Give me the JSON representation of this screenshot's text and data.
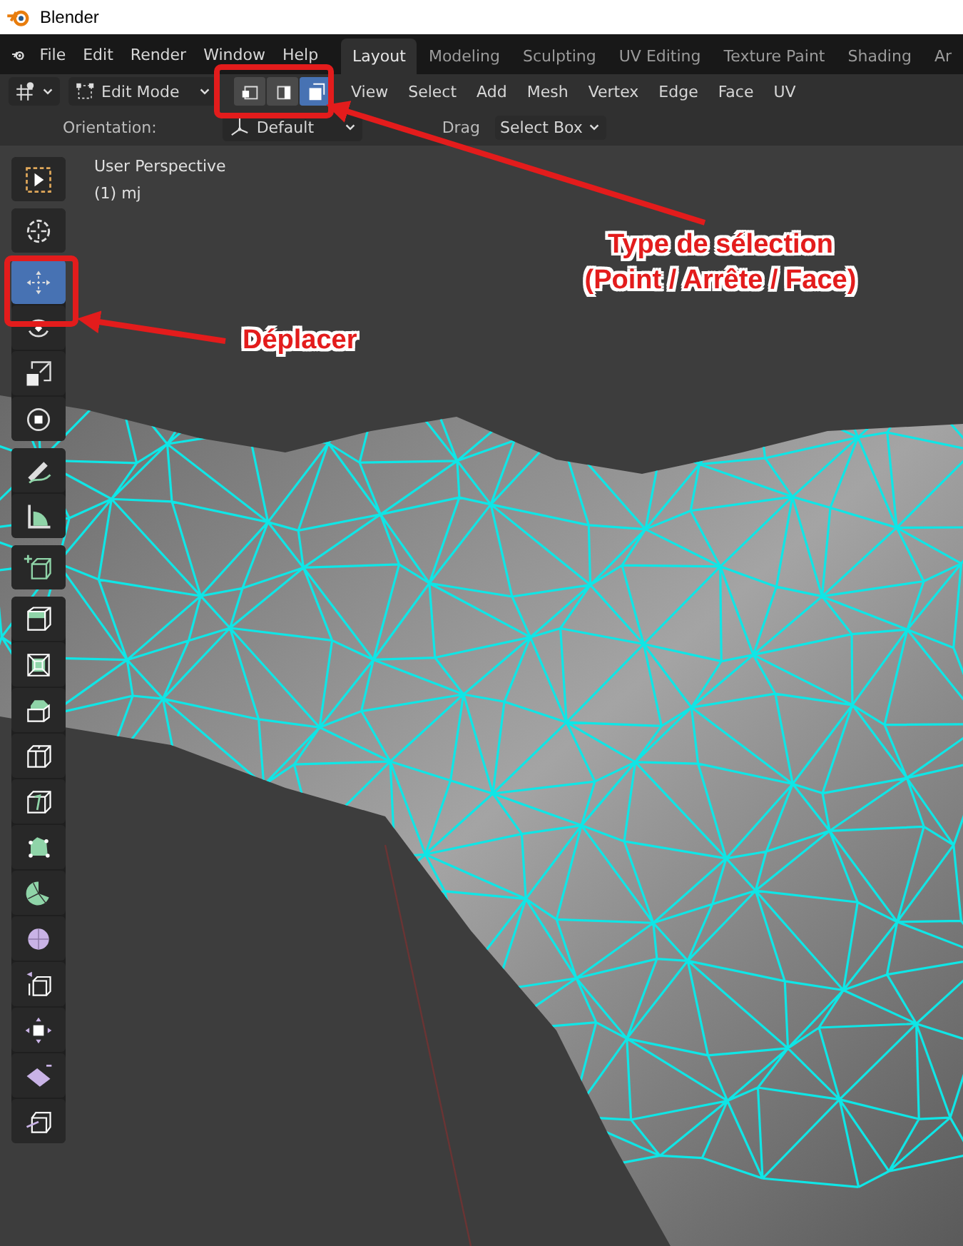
{
  "window": {
    "title": "Blender"
  },
  "menu": [
    "File",
    "Edit",
    "Render",
    "Window",
    "Help"
  ],
  "workspace_tabs": [
    {
      "label": "Layout",
      "selected": true
    },
    {
      "label": "Modeling",
      "selected": false
    },
    {
      "label": "Sculpting",
      "selected": false
    },
    {
      "label": "UV Editing",
      "selected": false
    },
    {
      "label": "Texture Paint",
      "selected": false
    },
    {
      "label": "Shading",
      "selected": false
    },
    {
      "label": "Ar",
      "selected": false
    }
  ],
  "header": {
    "mode": "Edit Mode",
    "select_modes": [
      {
        "kind": "vertex",
        "selected": false
      },
      {
        "kind": "edge",
        "selected": false
      },
      {
        "kind": "face",
        "selected": true
      }
    ],
    "menus": [
      "View",
      "Select",
      "Add",
      "Mesh",
      "Vertex",
      "Edge",
      "Face",
      "UV"
    ]
  },
  "tool_settings": {
    "orientation_label": "Orientation:",
    "orientation": "Default",
    "drag_label": "Drag",
    "drag": "Select Box"
  },
  "viewport": {
    "perspective": "User Perspective",
    "object": "(1) mj"
  },
  "toolbar": [
    [
      {
        "kind": "select-box",
        "selected": false
      }
    ],
    [
      {
        "kind": "cursor",
        "selected": false
      }
    ],
    [
      {
        "kind": "move",
        "selected": true
      },
      {
        "kind": "rotate",
        "selected": false
      },
      {
        "kind": "scale",
        "selected": false
      },
      {
        "kind": "transform",
        "selected": false
      }
    ],
    [
      {
        "kind": "annotate",
        "selected": false
      },
      {
        "kind": "measure",
        "selected": false
      }
    ],
    [
      {
        "kind": "add-cube",
        "selected": false
      }
    ],
    [
      {
        "kind": "extrude",
        "selected": false
      },
      {
        "kind": "inset",
        "selected": false
      },
      {
        "kind": "bevel",
        "selected": false
      },
      {
        "kind": "loop-cut",
        "selected": false
      },
      {
        "kind": "knife",
        "selected": false
      },
      {
        "kind": "poly-build",
        "selected": false
      },
      {
        "kind": "spin",
        "selected": false
      },
      {
        "kind": "smooth",
        "selected": false
      },
      {
        "kind": "edge-slide",
        "selected": false
      },
      {
        "kind": "shrink-fatten",
        "selected": false
      },
      {
        "kind": "shear",
        "selected": false
      },
      {
        "kind": "rip",
        "selected": false
      }
    ]
  ],
  "annotations": [
    {
      "lines": [
        "Type de sélection",
        "(Point / Arrête / Face)"
      ]
    },
    {
      "lines": [
        "Déplacer"
      ]
    }
  ]
}
